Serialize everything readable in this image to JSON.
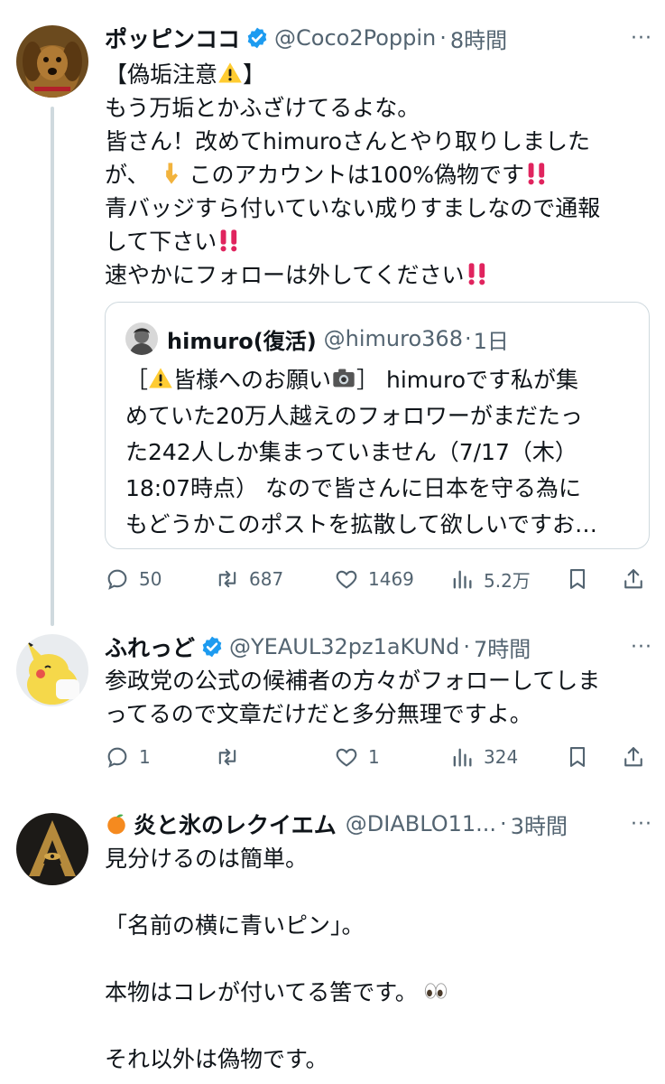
{
  "posts": [
    {
      "name": "ポッピンココ",
      "handle": "@Coco2Poppin",
      "dot": "·",
      "time": "8時間",
      "lines": [
        "【偽垢注意",
        "もう万垢とかふざけてるよな。",
        "皆さん！改めてhimuroさんとやり取りしました",
        "が、",
        "このアカウントは100%偽物です",
        "青バッジすら付いていない成りすましなので通報",
        "して下さい",
        "速やかにフォローは外してください"
      ],
      "line1_suffix": "】",
      "quote": {
        "name": "himuro(復活)",
        "handle": "@himuro368",
        "dot": "·",
        "time": "1日",
        "lines": [
          "［",
          "皆様へのお願い",
          "］ himuroです私が集",
          "めていた20万人越えのフォロワーがまだたっ",
          "た242人しか集まっていません（7/17（木）",
          "18:07時点） なので皆さんに日本を守る為に",
          "もどうかこのポストを拡散して欲しいですお…"
        ]
      },
      "stats": {
        "replies": "50",
        "reposts": "687",
        "likes": "1469",
        "views": "5.2万"
      }
    },
    {
      "name": "ふれっど",
      "handle": "@YEAUL32pz1aKUNd",
      "dot": "·",
      "time": "7時間",
      "lines": [
        "参政党の公式の候補者の方々がフォローしてしま",
        "ってるので文章だけだと多分無理ですよ。"
      ],
      "stats": {
        "replies": "1",
        "reposts": "",
        "likes": "1",
        "views": "324"
      }
    },
    {
      "name": "炎と氷のレクイエム",
      "handle": "@DIABLO11...",
      "dot": "·",
      "time": "3時間",
      "lines": [
        "見分けるのは簡単。",
        "",
        "「名前の横に青いピン」。",
        "",
        "本物はコレが付いてる筈です。",
        "",
        "それ以外は偽物です。"
      ]
    }
  ],
  "more_icon": "···",
  "colors": {
    "text": "#0f1419",
    "secondary": "#536471",
    "verified": "#1d9bf0",
    "border": "#cfd9de",
    "alert_red": "#e0245e"
  }
}
